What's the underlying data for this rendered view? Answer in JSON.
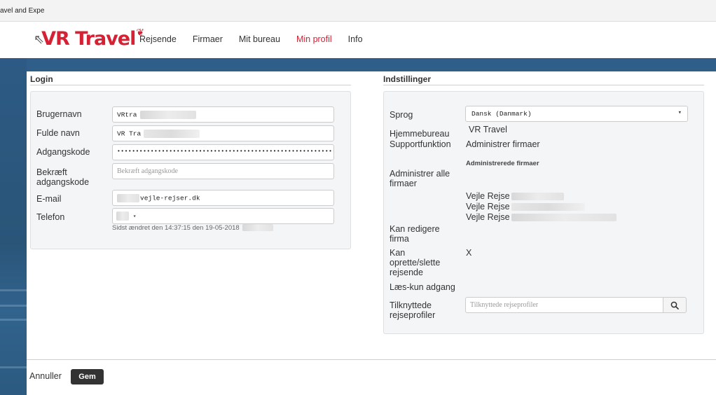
{
  "browser": {
    "tab_title": "avel and Expe"
  },
  "header": {
    "logo_text": "VR Travel",
    "nav": [
      "Rejsende",
      "Firmaer",
      "Mit bureau",
      "Min profil",
      "Info"
    ],
    "active_nav": "Min profil"
  },
  "login": {
    "title": "Login",
    "username_label": "Brugernavn",
    "username_value": "VRtra",
    "fullname_label": "Fulde navn",
    "fullname_value": "VR Tra",
    "password_label": "Adgangskode",
    "password_value": "•••••••••••••••••••••••••••••••••••••••••••••••••••••••••••••",
    "confirm_label_1": "Bekræft",
    "confirm_label_2": "adgangskode",
    "confirm_placeholder": "Bekræft adgangskode",
    "email_label": "E-mail",
    "email_value": "vejle-rejser.dk",
    "phone_label": "Telefon",
    "phone_caret": "▾",
    "last_changed": "Sidst ændret den 14:37:15 den 19-05-2018"
  },
  "settings": {
    "title": "Indstillinger",
    "language_label": "Sprog",
    "language_value": "Dansk (Danmark)",
    "language_caret": "▾",
    "home_bureau_label": "Hjemmebureau",
    "home_bureau_value": "VR Travel",
    "support_label": "Supportfunktion",
    "support_value": "Administrer firmaer",
    "managed_heading": "Administrerede firmaer",
    "admin_all_label_1": "Administrer alle",
    "admin_all_label_2": "firmaer",
    "companies": [
      "Vejle Rejse",
      "Vejle Rejse",
      "Vejle Rejse"
    ],
    "edit_label_1": "Kan redigere",
    "edit_label_2": "firma",
    "create_label_1": "Kan",
    "create_label_2": "oprette/slette",
    "create_label_3": "rejsende",
    "create_value": "X",
    "readonly_label": "Læs-kun adgang",
    "profiles_label_1": "Tilknyttede",
    "profiles_label_2": "rejseprofiler",
    "profiles_placeholder": "Tilknyttede rejseprofiler"
  },
  "footer": {
    "cancel": "Annuller",
    "save": "Gem"
  },
  "colors": {
    "brand_red": "#d62033",
    "band_blue": "#2f5e88",
    "button_dark": "#333333"
  }
}
